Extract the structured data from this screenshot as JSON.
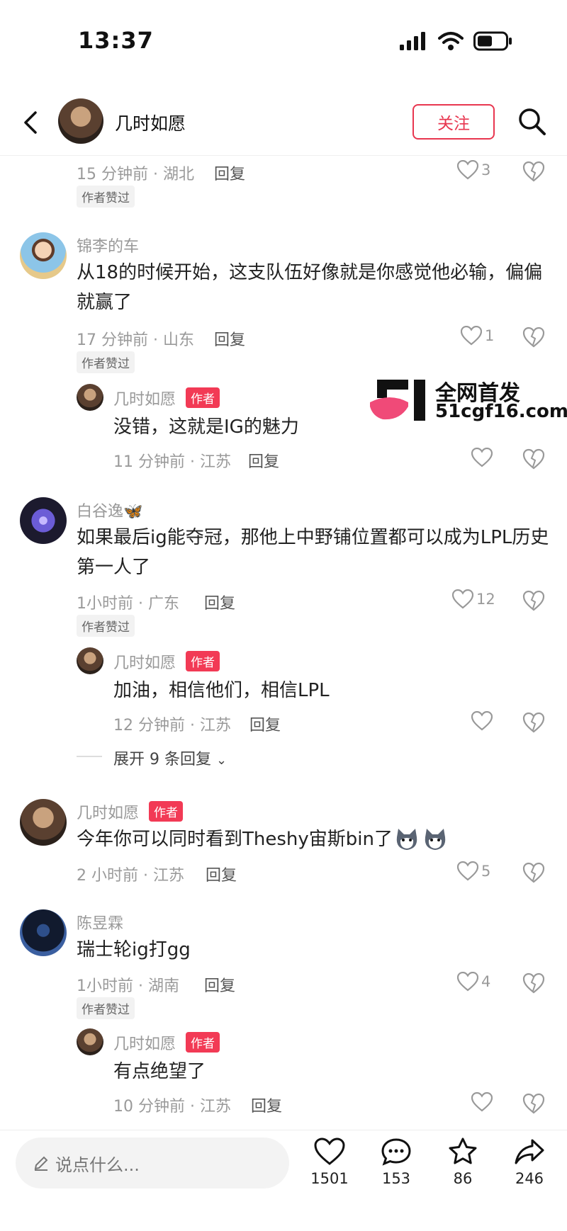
{
  "status": {
    "time": "13:37"
  },
  "header": {
    "name": "几时如愿",
    "follow_label": "关注"
  },
  "watermark": {
    "line1": "全网首发",
    "line2": "51cgf16.com"
  },
  "comments": [
    {
      "id": "c0",
      "meta": "15 分钟前 · 湖北",
      "reply": "回复",
      "likes": "3",
      "badge": "作者赞过"
    },
    {
      "id": "c1",
      "user": "锦李的车",
      "text": "从18的时候开始，这支队伍好像就是你感觉他必输，偏偏就赢了",
      "meta": "17 分钟前 · 山东",
      "reply": "回复",
      "likes": "1",
      "badge": "作者赞过",
      "sub": {
        "user": "几时如愿",
        "tag": "作者",
        "text": "没错，这就是IG的魅力",
        "meta": "11 分钟前 · 江苏",
        "reply": "回复"
      }
    },
    {
      "id": "c2",
      "user": "白谷逸🦋",
      "text": "如果最后ig能夺冠，那他上中野铺位置都可以成为LPL历史第一人了",
      "meta": "1小时前 · 广东",
      "reply": "回复",
      "likes": "12",
      "badge": "作者赞过",
      "sub": {
        "user": "几时如愿",
        "tag": "作者",
        "text": "加油，相信他们，相信LPL",
        "meta": "12 分钟前 · 江苏",
        "reply": "回复"
      },
      "expand": "展开 9 条回复"
    },
    {
      "id": "c3",
      "user": "几时如愿",
      "tag": "作者",
      "text": "今年你可以同时看到Theshy宙斯bin了",
      "meta": "2 小时前 · 江苏",
      "reply": "回复",
      "likes": "5"
    },
    {
      "id": "c4",
      "user": "陈昱霖",
      "text": "瑞士轮ig打gg",
      "meta": "1小时前 · 湖南",
      "reply": "回复",
      "likes": "4",
      "badge": "作者赞过",
      "sub": {
        "user": "几时如愿",
        "tag": "作者",
        "text": "有点绝望了",
        "meta": "10 分钟前 · 江苏",
        "reply": "回复"
      }
    }
  ],
  "bottom": {
    "placeholder": "说点什么...",
    "likes": "1501",
    "comments": "153",
    "stars": "86",
    "shares": "246"
  },
  "colors": {
    "accent": "#e8364f",
    "tag": "#f23a55"
  }
}
